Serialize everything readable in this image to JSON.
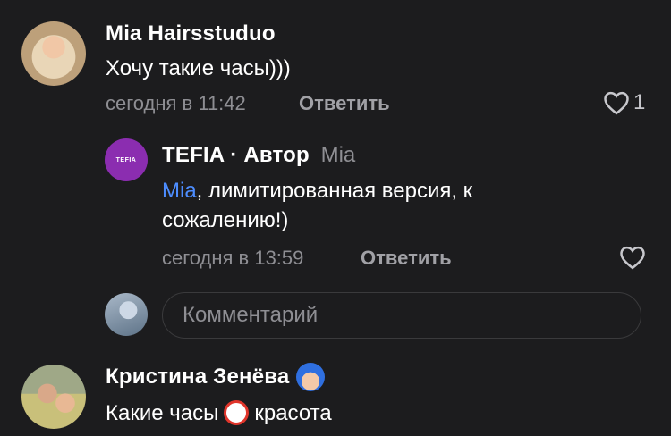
{
  "comments": [
    {
      "author": "Mia Hairsstuduo",
      "text": "Хочу такие часы)))",
      "time": "сегодня в 11:42",
      "reply_label": "Ответить",
      "likes": "1"
    },
    {
      "author": "TEFIA · Автор",
      "reply_to": "Mia",
      "avatar_text": "TEFIA",
      "mention": "Mia",
      "text_line1": ", лимитированная версия, к",
      "text_line2": "сожалению!)",
      "time": "сегодня в 13:59",
      "reply_label": "Ответить"
    },
    {
      "author": "Кристина Зенёва",
      "text_part1": "Какие часы",
      "text_part2": "красота"
    }
  ],
  "comment_input": {
    "placeholder": "Комментарий"
  },
  "colors": {
    "background": "#1c1c1e",
    "mention": "#4d8dff",
    "avatar_brand": "#8b2db0"
  },
  "icons": [
    "heart-icon",
    "alarm-clock-emoji",
    "superhero-emoji"
  ]
}
